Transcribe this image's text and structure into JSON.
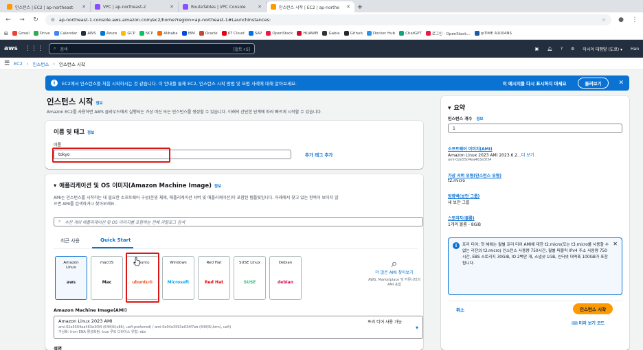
{
  "browser": {
    "tabs": [
      {
        "title": "인스턴스 | EC2 | ap-northeast-",
        "color": "#ff9900",
        "active": false
      },
      {
        "title": "VPC | ap-northeast-2",
        "color": "#8c4fff",
        "active": false
      },
      {
        "title": "RouteTables | VPC Console",
        "color": "#8c4fff",
        "active": false
      },
      {
        "title": "인스턴스 시작 | EC2 | ap-northe",
        "color": "#ff9900",
        "active": true
      }
    ],
    "new_tab": "+",
    "url": "ap-northeast-1.console.aws.amazon.com/ec2/home?region=ap-northeast-1#LaunchInstances:",
    "bookmarks": [
      {
        "label": "Gmail",
        "color": "#ea4335"
      },
      {
        "label": "Drive",
        "color": "#34a853"
      },
      {
        "label": "Calendar",
        "color": "#4285f4"
      },
      {
        "label": "AWS",
        "color": "#232f3e"
      },
      {
        "label": "Azure",
        "color": "#0078d4"
      },
      {
        "label": "GCP",
        "color": "#fbbc04"
      },
      {
        "label": "NCP",
        "color": "#03c75a"
      },
      {
        "label": "Alibaba",
        "color": "#ff6a00"
      },
      {
        "label": "IBM",
        "color": "#054ada"
      },
      {
        "label": "Oracle",
        "color": "#c74634"
      },
      {
        "label": "KT Cloud",
        "color": "#e60012"
      },
      {
        "label": "SAP",
        "color": "#0070f2"
      },
      {
        "label": "OpenStack",
        "color": "#ed1944"
      },
      {
        "label": "HUAWEI",
        "color": "#cf0a2c"
      },
      {
        "label": "Gabia",
        "color": "#333333"
      },
      {
        "label": "Github",
        "color": "#24292f"
      },
      {
        "label": "Docker Hub",
        "color": "#2496ed"
      },
      {
        "label": "ChatGPT",
        "color": "#10a37f"
      },
      {
        "label": "로그인 - OpenStack...",
        "color": "#ed1944"
      },
      {
        "label": "ipTIME A1004NS",
        "color": "#1c5aa6"
      }
    ]
  },
  "aws": {
    "logo": "aws",
    "search_placeholder": "검색",
    "search_shortcut": "[알트+S]",
    "region": "아시아 태평양 (도쿄) ▾",
    "user": "Han"
  },
  "breadcrumb": {
    "items": [
      "EC2",
      "인스턴스",
      "인스턴스 시작"
    ]
  },
  "banner": {
    "message": "EC2에서 인스턴스를 처음 시작하시는 것 같습니다. 이 안내를 통해 EC2, 인스턴스 시작 방법 및 모범 사례에 대해 알아보세요.",
    "dismiss": "이 메시지를 다시 표시하지 마세요",
    "open": "둘러보기"
  },
  "page": {
    "title": "인스턴스 시작",
    "info": "정보",
    "description": "Amazon EC2를 사용하면 AWS 클라우드에서 실행되는 가상 머신 또는 인스턴스를 생성할 수 있습니다. 아래의 간단한 단계에 따라 빠르게 시작할 수 있습니다."
  },
  "name_tags": {
    "heading": "이름 및 태그",
    "info": "정보",
    "name_label": "이름",
    "name_value": "tokyo",
    "add_tag": "추가 태그 추가"
  },
  "ami": {
    "heading": "애플리케이션 및 OS 이미지(Amazon Machine Image)",
    "info": "정보",
    "desc1": "AMI는 인스턴스를 시작하는 데 필요한 소프트웨어 구성(운영 체제, 애플리케이션 서버 및 애플리케이션)이 포함된 템플릿입니다. 아래에서 찾고 있는 항목이 보이지 않",
    "desc2": "으면 AMI를 검색하거나 찾아보세요.",
    "search_placeholder": "수천 개의 애플리케이션 및 OS 이미지를 포함하는 전체 카탈로그 검색",
    "tabs": [
      "최근 사용",
      "Quick Start"
    ],
    "tiles": [
      {
        "name1": "Amazon",
        "name2": "Linux",
        "logo": "aws",
        "logo_color": "#232f3e"
      },
      {
        "name1": "macOS",
        "name2": "",
        "logo": "Mac",
        "logo_color": "#16191f"
      },
      {
        "name1": "Ubuntu",
        "name2": "",
        "logo": "ubuntu®",
        "logo_color": "#e95420"
      },
      {
        "name1": "Windows",
        "name2": "",
        "logo": "Microsoft",
        "logo_color": "#00a4ef"
      },
      {
        "name1": "Red Hat",
        "name2": "",
        "logo": "Red Hat",
        "logo_color": "#ee0000"
      },
      {
        "name1": "SUSE Linux",
        "name2": "",
        "logo": "SUSE",
        "logo_color": "#30ba78"
      },
      {
        "name1": "Debian",
        "name2": "",
        "logo": "debian",
        "logo_color": "#d70a53"
      }
    ],
    "more_label": "더 많은 AMI 찾아보기",
    "more_sub": "AWS, Marketplace 및 커뮤니티의 AMI 포함",
    "ami_label": "Amazon Machine Image(AMI)",
    "ami_name": "Amazon Linux 2023 AMI",
    "ami_ids": "ami-02e5504ea463e3f34 (64비트(x86), uefi-preferred) / ami-0e04e3593e034f7eb (64비트(Arm), uefi)",
    "ami_meta": "가상화: hvm    ENA 활성화됨: true    루트 디바이스 유형: ebs",
    "free_tier": "프리 티어 사용 가능",
    "next_label": "설명"
  },
  "summary": {
    "heading": "요약",
    "count_label": "인스턴스 개수",
    "count_info": "정보",
    "count_value": "1",
    "sw_label": "소프트웨어 이미지(AMI)",
    "sw_value": "Amazon Linux 2023 AMI 2023.6.2...",
    "sw_more": "더 보기",
    "sw_id": "ami-02e5504ea463e3f34",
    "type_label": "가상 서버 유형(인스턴스 유형)",
    "type_value": "t2.micro",
    "fw_label": "방화벽(보안 그룹)",
    "fw_value": "새 보안 그룹",
    "storage_label": "스토리지(볼륨)",
    "storage_value": "1개의 볼륨 - 8GiB",
    "free_tier_text": "프리 티어: 첫 해에는 월별 프리 티어 AMI에 대한 t2.micro(또는 t3.micro를 사용할 수 없는 리전의 t3.micro) 인스턴스 사용량 750시간, 월별 퍼블릭 IPv4 주소 사용량 750시간, EBS 스토리지 30GiB, IO 2백만 개, 스냅샷 1GB, 인터넷 대역폭 100GB가 포함됩니다.",
    "cancel": "취소",
    "launch": "인스턴스 시작",
    "preview": "미리 보기 코드"
  }
}
